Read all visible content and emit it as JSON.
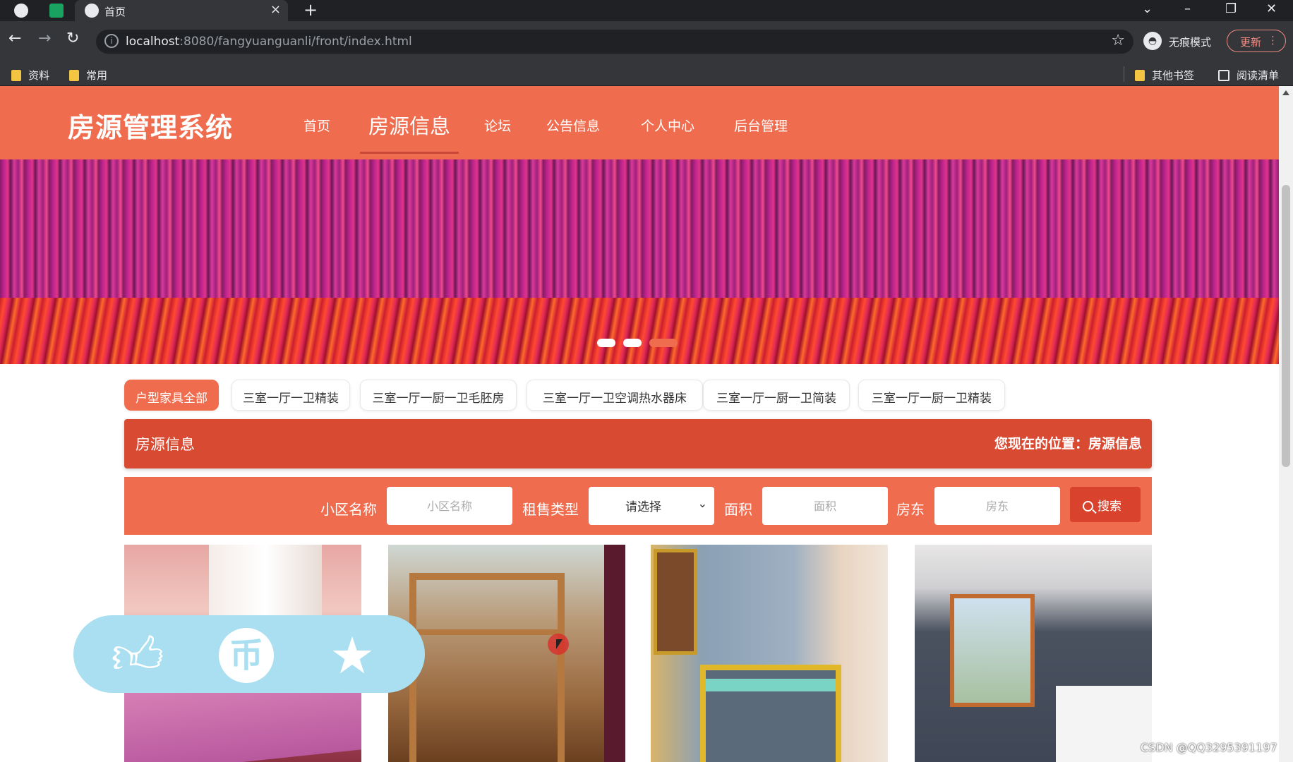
{
  "browser": {
    "tab_title": "首页",
    "url_host": "localhost",
    "url_rest": ":8080/fangyuanguanli/front/index.html",
    "incognito_label": "无痕模式",
    "update_label": "更新",
    "bookmarks": [
      "资料",
      "常用"
    ],
    "other_bookmarks": "其他书签",
    "reading_list": "阅读清单"
  },
  "header": {
    "logo": "房源管理系统",
    "nav": [
      "首页",
      "房源信息",
      "论坛",
      "公告信息",
      "个人中心",
      "后台管理"
    ],
    "active_index": 1
  },
  "banner": {
    "slide_count": 3,
    "active_slide": 3
  },
  "filters": [
    "户型家具全部",
    "三室一厅一卫精装",
    "三室一厅一厨一卫毛胚房",
    "三室一厅一卫空调热水器床",
    "三室一厅一厨一卫简装",
    "三室一厅一厨一卫精装"
  ],
  "section": {
    "title": "房源信息",
    "breadcrumb": "您现在的位置：房源信息"
  },
  "search": {
    "community_label": "小区名称",
    "community_placeholder": "小区名称",
    "type_label": "租售类型",
    "type_value": "请选择",
    "area_label": "面积",
    "area_placeholder": "面积",
    "landlord_label": "房东",
    "landlord_placeholder": "房东",
    "button": "搜索"
  },
  "overlay": {
    "icons": [
      "like-icon",
      "coin-icon",
      "favorite-icon"
    ],
    "coin_glyph": "币"
  },
  "watermark": "CSDN @QQ3295391197",
  "colors": {
    "primary": "#ef6c4e",
    "dark_primary": "#d94a32",
    "social_bg": "#a9dff0"
  }
}
